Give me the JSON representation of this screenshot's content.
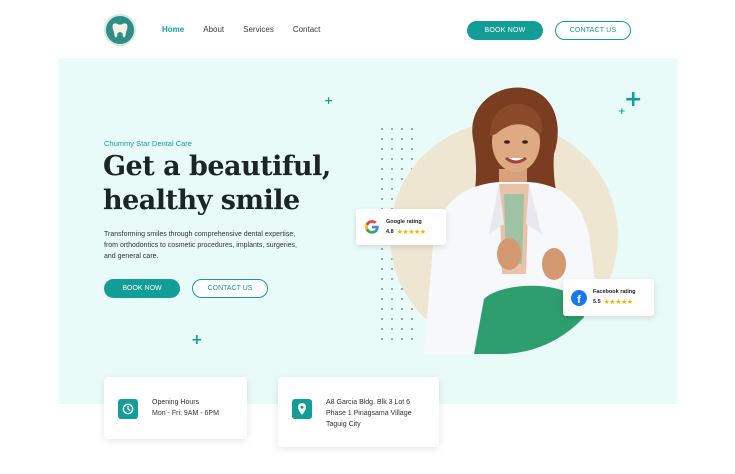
{
  "header": {
    "nav": [
      {
        "label": "Home",
        "active": true
      },
      {
        "label": "About",
        "active": false
      },
      {
        "label": "Services",
        "active": false
      },
      {
        "label": "Contact",
        "active": false
      }
    ],
    "book_label": "BOOK NOW",
    "contact_label": "CONTACT US"
  },
  "hero": {
    "brand": "Chummy Star Dental Care",
    "title_line1": "Get a beautiful,",
    "title_line2": "healthy smile",
    "description": "Transforming smiles through comprehensive dental expertise, from orthodontics to cosmetic procedures, implants, surgeries, and general care.",
    "book_label": "BOOK NOW",
    "contact_label": "CONTACT US"
  },
  "ratings": {
    "google": {
      "title": "Google rating",
      "score": "4.8",
      "stars": "★★★★★",
      "icon": "google-icon"
    },
    "facebook": {
      "title": "Facebook rating",
      "score": "5.5",
      "stars": "★★★★★",
      "icon": "facebook-icon"
    }
  },
  "info": {
    "hours": {
      "line1": "Opening Hours",
      "line2": "Mon - Fri: 9AM - 6PM",
      "icon": "clock-icon"
    },
    "address": {
      "line1": "A8 Garcia Bldg.  Blk 3 Lot 6",
      "line2": "Phase 1 Pinagsama Village",
      "line3": "Taguig City",
      "icon": "map-pin-icon"
    }
  },
  "colors": {
    "accent": "#129e97",
    "hero_bg": "#e9fbf9",
    "circle_bg": "#efe6d2",
    "star": "#f5b301"
  }
}
